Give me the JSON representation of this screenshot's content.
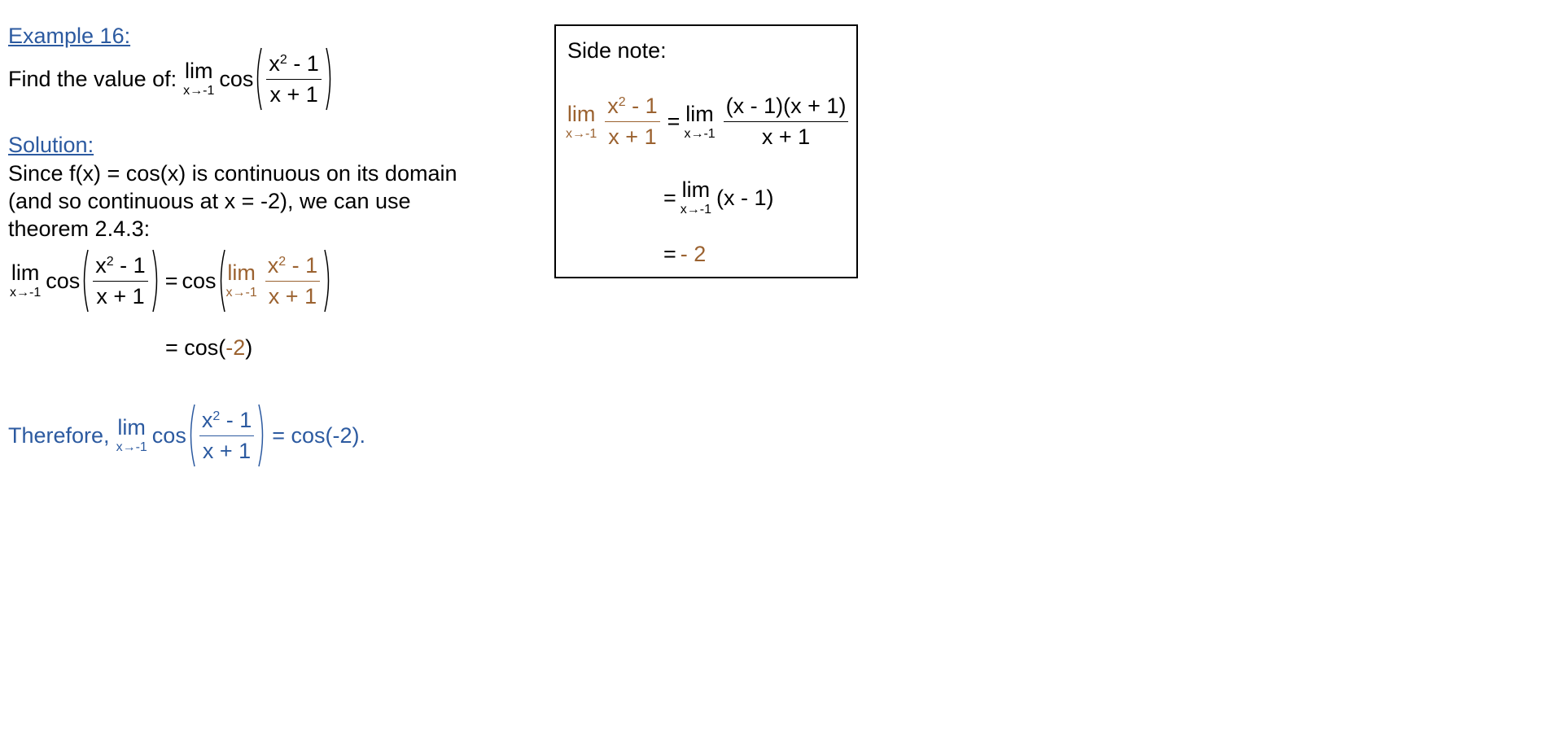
{
  "example": {
    "heading": "Example 16:",
    "prompt": "Find the value of:"
  },
  "math": {
    "lim": "lim",
    "cos": "cos",
    "sub": "x→-1",
    "num_base": "x",
    "num_exp": "2",
    "num_tail": " - 1",
    "den": "x + 1",
    "eq": "="
  },
  "solution": {
    "heading": "Solution:",
    "lines": [
      "Since f(x) = cos(x) is continuous on its domain",
      "(and so continuous at x = -2), we can use",
      "theorem 2.4.3:"
    ],
    "step2_prefix": "= cos(",
    "step2_value": "-2",
    "step2_suffix": ")"
  },
  "conclusion": {
    "prefix": "Therefore,",
    "result": "= cos(-2)."
  },
  "side_note": {
    "title": "Side note:",
    "factored_num": "(x - 1)(x + 1)",
    "den": "x + 1",
    "simplified": "(x - 1)",
    "final_value": "- 2"
  }
}
